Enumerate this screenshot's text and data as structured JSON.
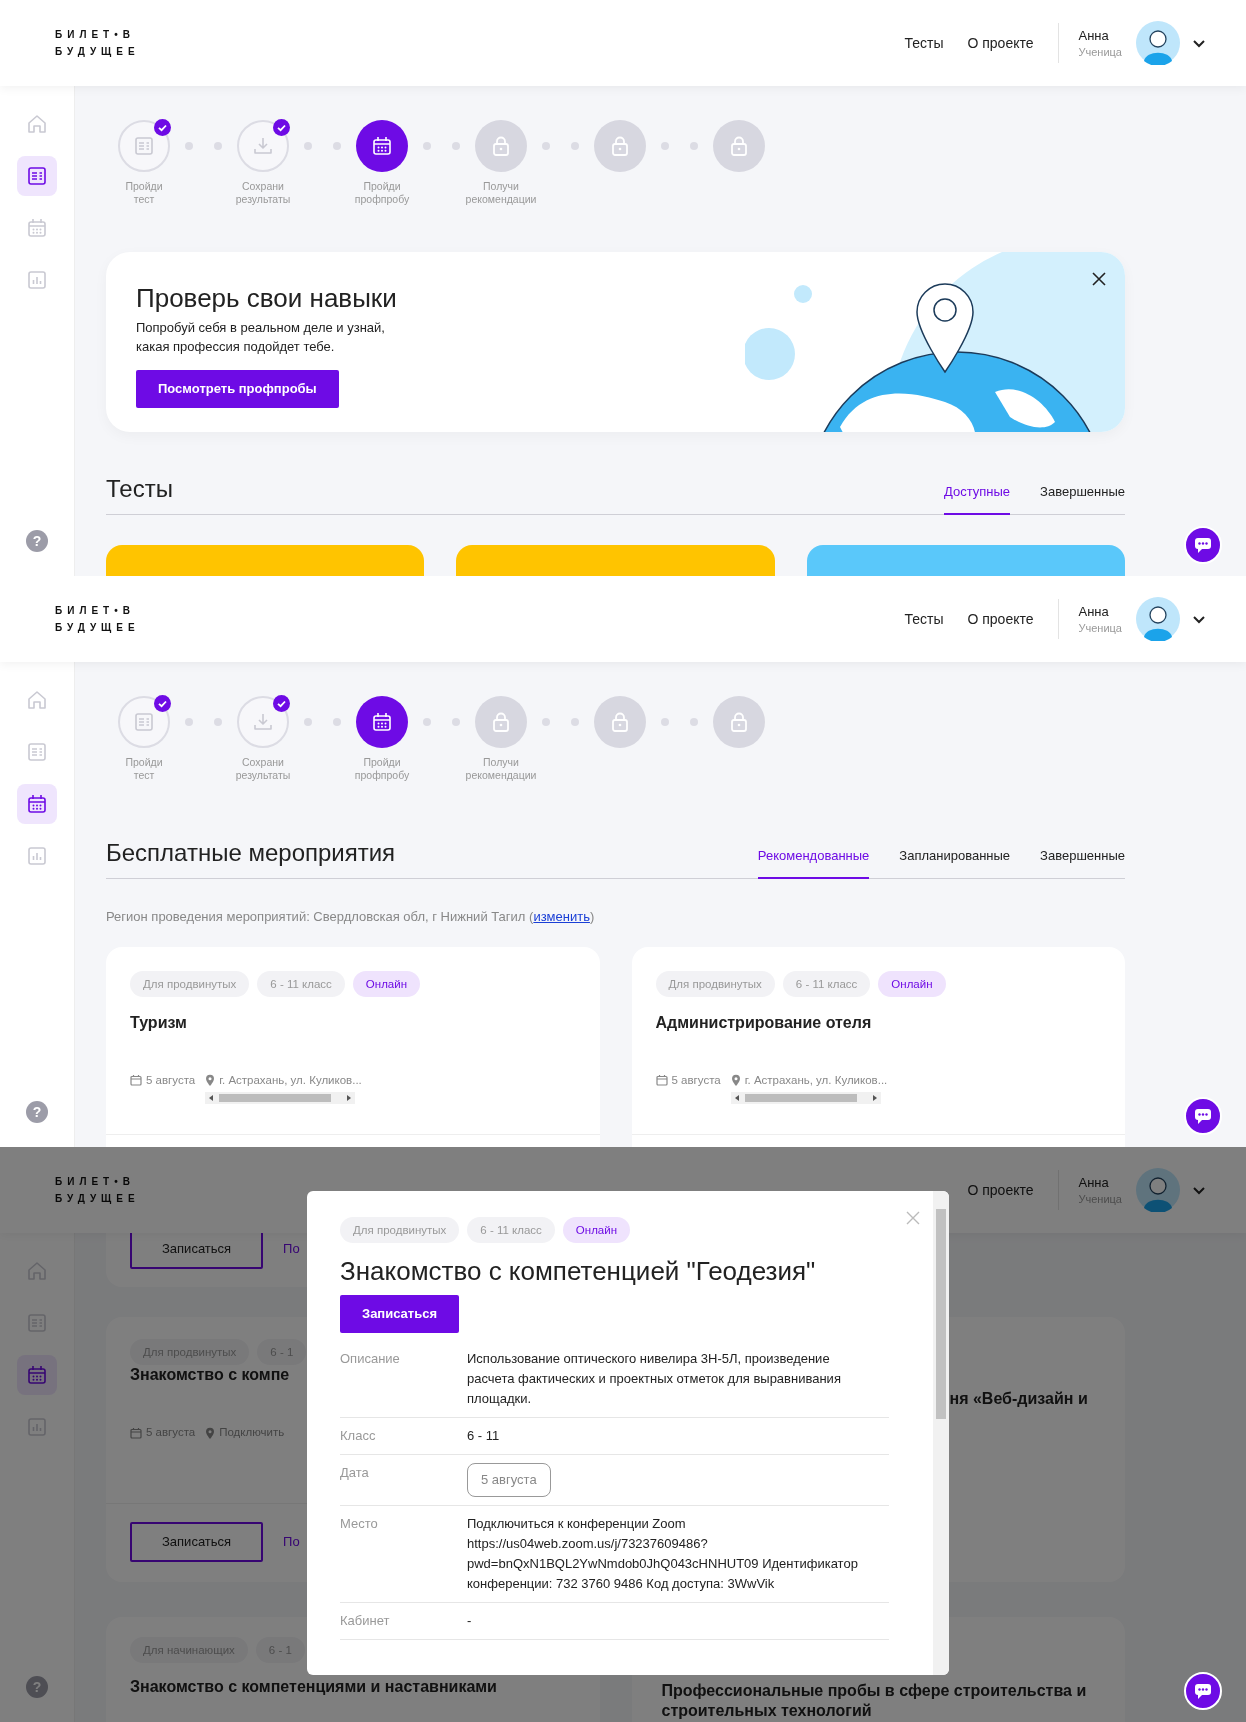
{
  "screens": [
    {
      "kind": "tests",
      "header": {
        "logo": [
          "БИЛЕТ•В",
          "БУДУЩЕЕ"
        ],
        "nav": [
          "Тесты",
          "О проекте"
        ],
        "user_name": "Анна",
        "user_role": "Ученица"
      },
      "sidebar": [
        {
          "selected": false
        },
        {
          "selected": true
        },
        {
          "selected": false
        },
        {
          "selected": false
        }
      ],
      "help": "?",
      "steps": [
        {
          "label": "Пройди\nтест",
          "completed": true,
          "locked": false
        },
        {
          "label": "Сохрани\nрезультаты",
          "completed": true,
          "locked": false
        },
        {
          "label": "Пройди\nпрофпробу",
          "completed": false,
          "locked": false
        },
        {
          "label": "Получи\nрекомендации",
          "completed": false,
          "locked": true
        },
        {
          "completed": false,
          "locked": true
        },
        {
          "completed": false,
          "locked": true
        }
      ],
      "banner": {
        "title": "Проверь свои навыки",
        "text": "Попробуй себя в реальном деле и узнай,\nкакая профессия подойдет тебе.",
        "button": "Посмотреть профпробы"
      },
      "section": {
        "title": "Тесты",
        "tabs": [
          {
            "label": "Доступные",
            "selected": true
          },
          {
            "label": "Завершенные",
            "selected": false
          }
        ]
      },
      "test_cards": [
        {
          "color": "#ffc400"
        },
        {
          "color": "#ffc400"
        },
        {
          "color": "#5ac8fa"
        }
      ]
    },
    {
      "kind": "events",
      "header": {
        "logo": [
          "БИЛЕТ•В",
          "БУДУЩЕЕ"
        ],
        "nav": [
          "Тесты",
          "О проекте"
        ],
        "user_name": "Анна",
        "user_role": "Ученица"
      },
      "sidebar": [
        {
          "selected": false
        },
        {
          "selected": false
        },
        {
          "selected": true
        },
        {
          "selected": false
        }
      ],
      "help": "?",
      "steps": [
        {
          "label": "Пройди\nтест",
          "completed": true,
          "locked": false
        },
        {
          "label": "Сохрани\nрезультаты",
          "completed": true,
          "locked": false
        },
        {
          "label": "Пройди\nпрофпробу",
          "completed": false,
          "locked": false
        },
        {
          "label": "Получи\nрекомендации",
          "completed": false,
          "locked": true
        },
        {
          "completed": false,
          "locked": true
        },
        {
          "completed": false,
          "locked": true
        }
      ],
      "section": {
        "title": "Бесплатные мероприятия",
        "tabs": [
          {
            "label": "Рекомендованные",
            "selected": true
          },
          {
            "label": "Запланированные",
            "selected": false
          },
          {
            "label": "Завершенные",
            "selected": false
          }
        ]
      },
      "region": {
        "text": "Регион проведения мероприятий: Свердловская обл, г Нижний Тагил (",
        "link": "изменить",
        "after": ")"
      },
      "events": [
        {
          "tags": [
            {
              "text": "Для продвинутых",
              "kind": "plain"
            },
            {
              "text": "6 - 11 класс",
              "kind": "plain"
            },
            {
              "text": "Онлайн",
              "kind": "accent"
            }
          ],
          "title": "Туризм",
          "date": "5 августа",
          "location": "г. Астрахань, ул. Куликов..."
        },
        {
          "tags": [
            {
              "text": "Для продвинутых",
              "kind": "plain"
            },
            {
              "text": "6 - 11 класс",
              "kind": "plain"
            },
            {
              "text": "Онлайн",
              "kind": "accent"
            }
          ],
          "title": "Администрирование отеля",
          "date": "5 августа",
          "location": "г. Астрахань, ул. Куликов..."
        }
      ]
    },
    {
      "kind": "event_detail",
      "header": {
        "logo": [
          "БИЛЕТ•В",
          "БУДУЩЕЕ"
        ],
        "nav": [
          "О проекте"
        ],
        "user_name": "Анна",
        "user_role": "Ученица"
      },
      "sidebar": [
        {
          "selected": false
        },
        {
          "selected": false
        },
        {
          "selected": true
        },
        {
          "selected": false
        }
      ],
      "help": "?",
      "background": {
        "top_button": "Записаться",
        "top_link": "По",
        "card_a": {
          "tags": [
            "Для продвинутых",
            "6 - 1"
          ],
          "title": "Знакомство с компе",
          "date": "5 августа",
          "location": "Подключить",
          "button": "Записаться",
          "link": "По"
        },
        "card_b": {
          "title": "ня «Веб-дизайн и"
        },
        "card_c": {
          "tags": [
            "Для начинающих",
            "6 - 1"
          ],
          "title": "Знакомство с компетенциями и наставниками"
        },
        "card_d": {
          "title": "Профессиональные пробы в сфере строительства и строительных технологий"
        }
      },
      "modal": {
        "tags": [
          {
            "text": "Для продвинутых",
            "kind": "plain"
          },
          {
            "text": "6 - 11 класс",
            "kind": "plain"
          },
          {
            "text": "Онлайн",
            "kind": "accent"
          }
        ],
        "title": "Знакомство с компетенцией \"Геодезия\"",
        "button": "Записаться",
        "rows": [
          {
            "label": "Описание",
            "value": "Использование оптического нивелира 3Н-5Л, произведение расчета фактических и проектных отметок для выравнивания площадки.",
            "kind": "text"
          },
          {
            "label": "Класс",
            "value": "6 - 11",
            "kind": "text"
          },
          {
            "label": "Дата",
            "value": "5 августа",
            "kind": "pill"
          },
          {
            "label": "Место",
            "value": "Подключиться к конференции Zoom https://us04web.zoom.us/j/73237609486?pwd=bnQxN1BQL2YwNmdob0JhQ043cHNHUT09 Идентификатор конференции: 732 3760 9486 Код доступа: 3WwVik",
            "kind": "text"
          },
          {
            "label": "Кабинет",
            "value": "-",
            "kind": "text"
          }
        ]
      }
    }
  ]
}
